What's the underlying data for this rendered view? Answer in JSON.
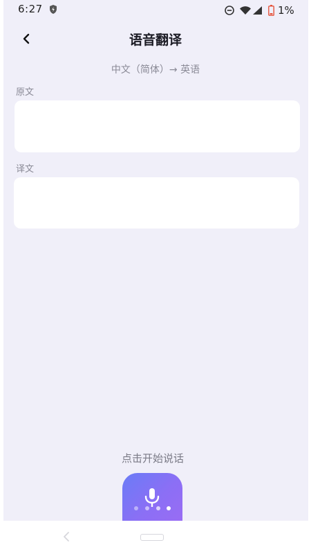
{
  "status_bar": {
    "time": "6:27",
    "battery": "1%",
    "icons": [
      "shield-icon",
      "do-not-disturb-icon",
      "wifi-icon",
      "cell-signal-icon",
      "battery-icon"
    ]
  },
  "header": {
    "title": "语音翻译",
    "back_icon": "chevron-left-icon"
  },
  "language_pair": "中文（简体）→ 英语",
  "source": {
    "label": "原文",
    "value": ""
  },
  "target": {
    "label": "译文",
    "value": ""
  },
  "hint": "点击开始说话",
  "mic": {
    "icon": "microphone-icon"
  },
  "nav": {
    "back_icon": "nav-back-icon",
    "home_icon": "nav-home-icon"
  },
  "colors": {
    "background": "#f0eff9",
    "card": "#ffffff",
    "accent_start": "#6a7cf6",
    "accent_end": "#9a6cf4",
    "muted_text": "#8a8a96"
  }
}
